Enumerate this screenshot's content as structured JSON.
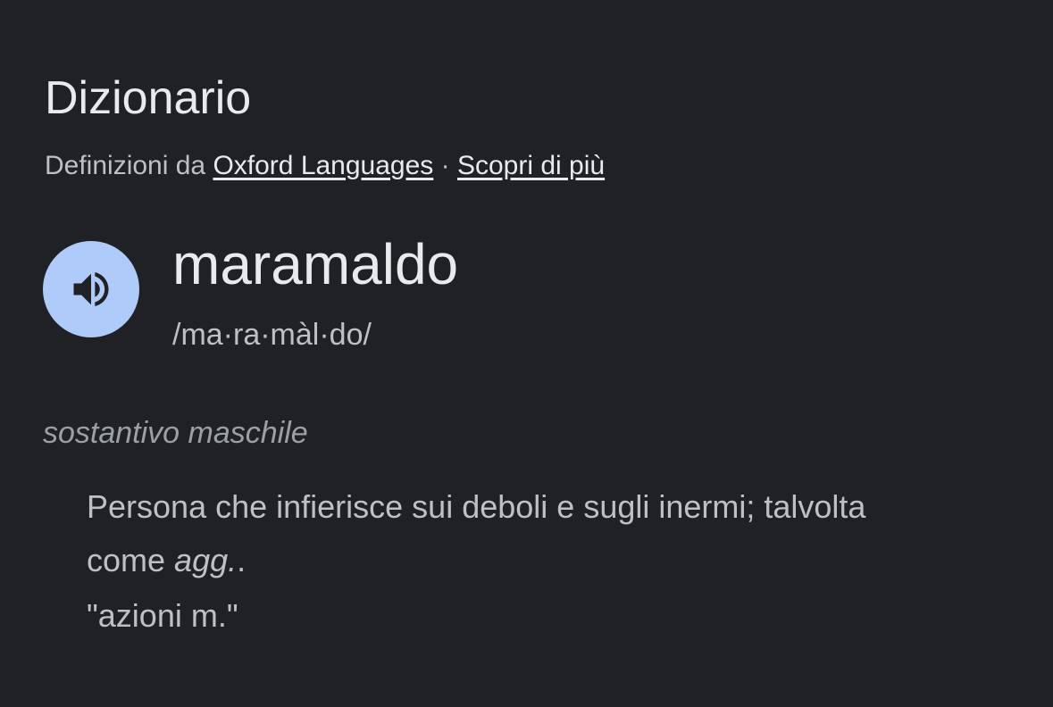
{
  "section": {
    "title": "Dizionario"
  },
  "source": {
    "prefix": "Definizioni da",
    "link_label": "Oxford Languages",
    "separator": "·",
    "more_label": "Scopri di più"
  },
  "entry": {
    "audio_icon": "speaker-icon",
    "headword": "maramaldo",
    "pronunciation": "/ma·ra·màl·do/",
    "part_of_speech": "sostantivo maschile",
    "definition": {
      "line1": "Persona che infierisce sui deboli e sugli inermi; talvolta",
      "line2_start": "come",
      "line2_abbrev": "agg.",
      "line2_end": "."
    },
    "example": "\"azioni m.\""
  },
  "colors": {
    "background": "#202124",
    "primary_text": "#e8eaed",
    "secondary_text": "#bdc1c6",
    "muted_text": "#9aa0a6",
    "audio_button": "#aecbfa",
    "audio_icon": "#202124"
  }
}
